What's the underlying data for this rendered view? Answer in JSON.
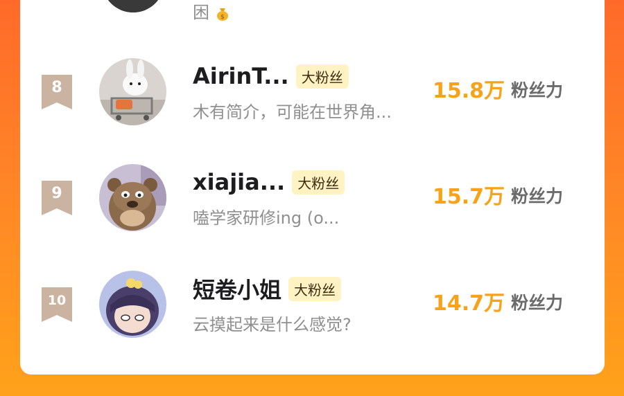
{
  "previous_entry": {
    "bio_fragment": "困",
    "emoji_icon": "money-bag-emoji-icon"
  },
  "entries": [
    {
      "rank": "8",
      "name": "AirinT...",
      "tag": "大粉丝",
      "bio": "木有简介，可能在世界角...",
      "fan_count": "15.8万",
      "fan_label": "粉丝力",
      "avatar_icon": "rabbit-avatar-icon"
    },
    {
      "rank": "9",
      "name": "xiajia...",
      "tag": "大粉丝",
      "bio": "嗑学家研修ing (o...",
      "fan_count": "15.7万",
      "fan_label": "粉丝力",
      "avatar_icon": "cartoon-bear-avatar-icon"
    },
    {
      "rank": "10",
      "name": "短卷小姐",
      "tag": "大粉丝",
      "bio": "云摸起来是什么感觉?",
      "fan_count": "14.7万",
      "fan_label": "粉丝力",
      "avatar_icon": "anime-girl-avatar-icon"
    }
  ],
  "colors": {
    "background_gradient_top": "#ff6a2a",
    "background_gradient_bottom": "#ffa21a",
    "fan_count": "#f6a21a",
    "rank_badge": "#cbb3a1",
    "tag_background": "#fff3c4"
  }
}
